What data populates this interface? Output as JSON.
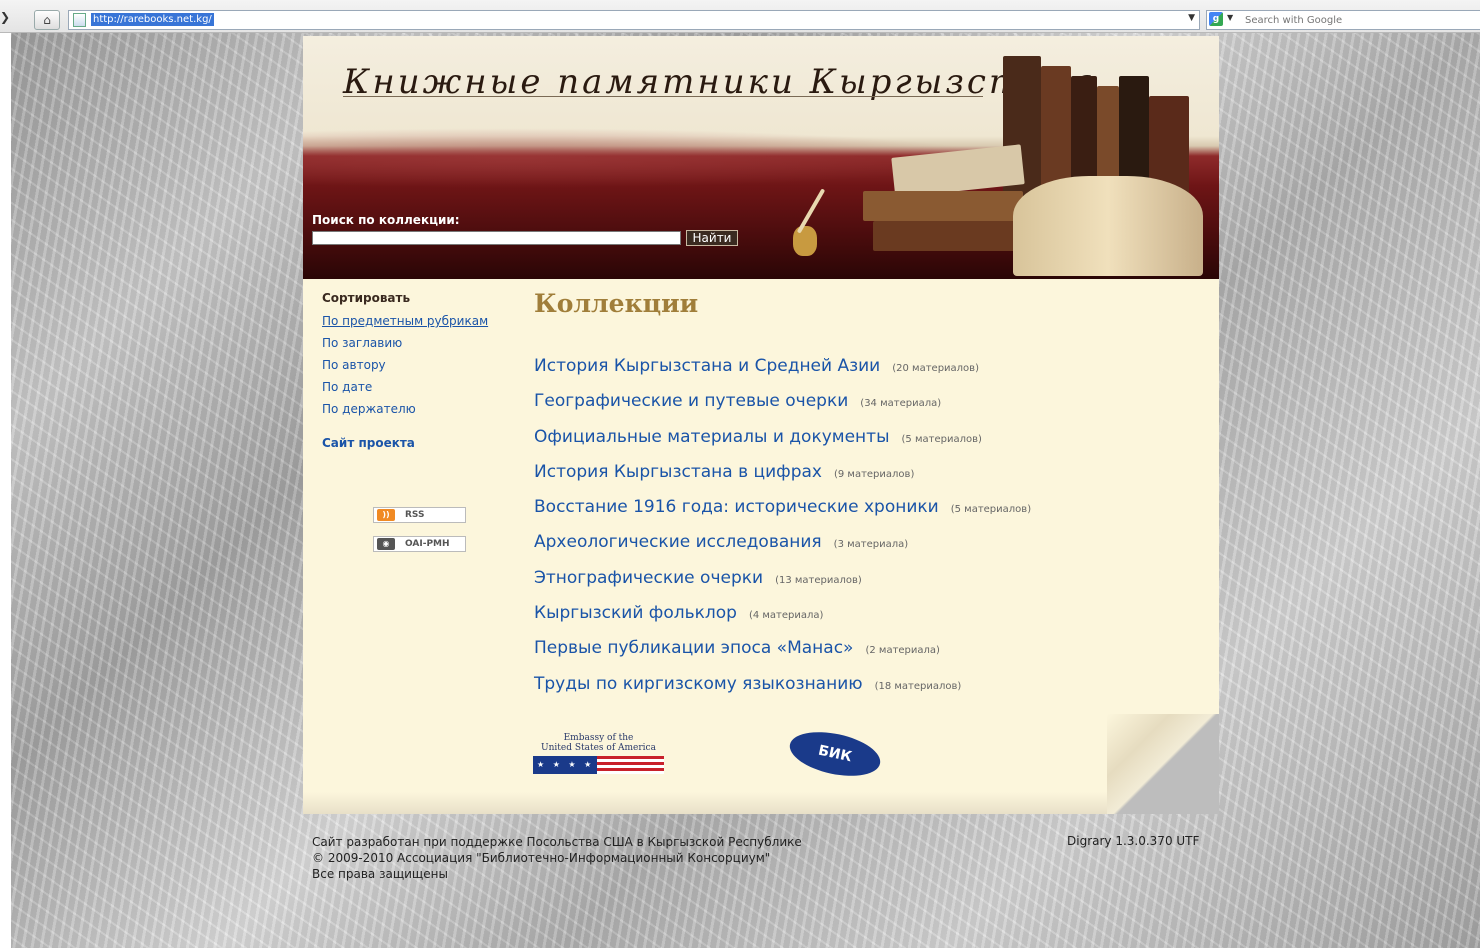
{
  "browser": {
    "url": "http://rarebooks.net.kg/",
    "search_placeholder": "Search with Google"
  },
  "header": {
    "title": "Книжные памятники Кыргызстана",
    "search_label": "Поиск по коллекции:",
    "search_button": "Найти"
  },
  "sidebar": {
    "sort_title": "Сортировать",
    "links": [
      "По предметным рубрикам",
      "По заглавию",
      "По автору",
      "По дате",
      "По держателю"
    ],
    "project_link": "Сайт проекта",
    "badges": [
      {
        "label": "RSS",
        "icon": "rss-icon",
        "color": "#f08a24"
      },
      {
        "label": "OAI-PMH",
        "icon": "oai-pmh-icon",
        "color": "#555555"
      }
    ]
  },
  "main": {
    "heading": "Коллекции",
    "collections": [
      {
        "title": "История Кыргызстана и Средней Азии",
        "count": "(20 материалов)"
      },
      {
        "title": "Географические и путевые очерки",
        "count": "(34 материала)"
      },
      {
        "title": "Официальные материалы и документы",
        "count": "(5 материалов)"
      },
      {
        "title": "История Кыргызстана в цифрах",
        "count": "(9 материалов)"
      },
      {
        "title": "Восстание 1916 года: исторические хроники",
        "count": "(5 материалов)"
      },
      {
        "title": "Археологические исследования",
        "count": "(3 материала)"
      },
      {
        "title": "Этнографические очерки",
        "count": "(13 материалов)"
      },
      {
        "title": "Кыргызский фольклор",
        "count": "(4 материала)"
      },
      {
        "title": "Первые публикации эпоса «Манас»",
        "count": "(2 материала)"
      },
      {
        "title": "Труды по киргизскому языкознанию",
        "count": "(18 материалов)"
      }
    ]
  },
  "partners": {
    "embassy_line1": "Embassy of the",
    "embassy_line2": "United States of America",
    "embassy_stars": "★ ★ ★ ★",
    "bik_label": "БИК"
  },
  "footer": {
    "line1": "Сайт разработан при поддержке Посольства США в Кыргызской Республике",
    "line2": "© 2009-2010 Ассоциация \"Библиотечно-Информационный Консорциум\"",
    "line3": "Все права защищены",
    "version": "Digrary 1.3.0.370 UTF"
  },
  "colors": {
    "link": "#1a54a8",
    "heading": "#a07e3a",
    "content_bg": "#fcf6dc",
    "banner_red": "#6e1516"
  }
}
